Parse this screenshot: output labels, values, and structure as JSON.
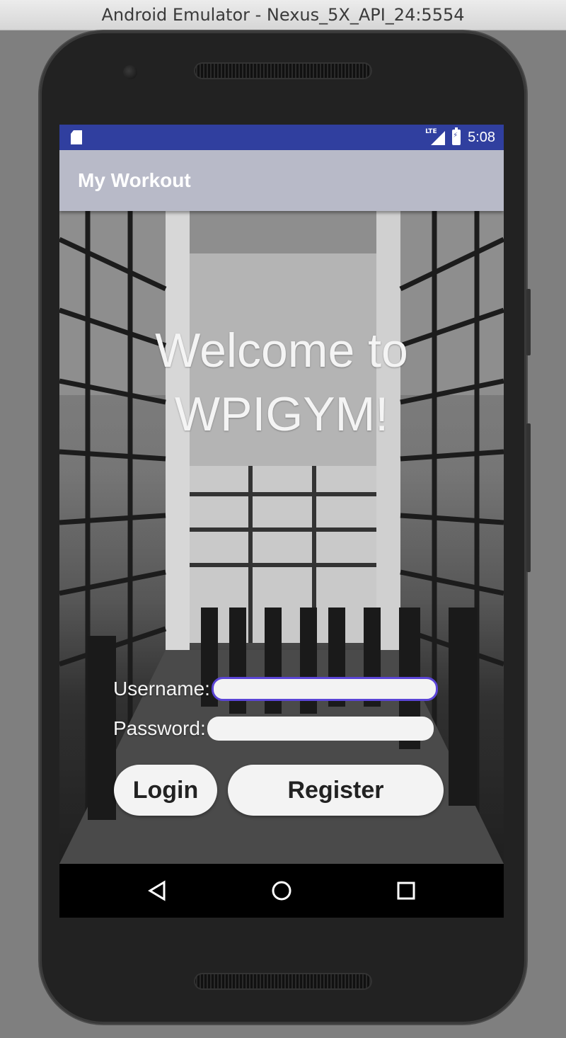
{
  "window": {
    "title": "Android Emulator - Nexus_5X_API_24:5554"
  },
  "statusbar": {
    "time": "5:08",
    "network": "LTE",
    "left_icon": "sd-card-icon",
    "colors": {
      "bg": "#303f9f"
    }
  },
  "appbar": {
    "title": "My Workout",
    "colors": {
      "bg": "#b8bac8"
    }
  },
  "welcome": {
    "line1": "Welcome to",
    "line2": "WPIGYM!"
  },
  "form": {
    "username_label": "Username:",
    "username_value": "",
    "password_label": "Password:",
    "password_value": "",
    "focus_color": "#5b45d6"
  },
  "buttons": {
    "login": "Login",
    "register": "Register"
  },
  "navbar": {
    "icons": [
      "back-triangle-icon",
      "home-circle-icon",
      "recents-square-icon"
    ]
  }
}
